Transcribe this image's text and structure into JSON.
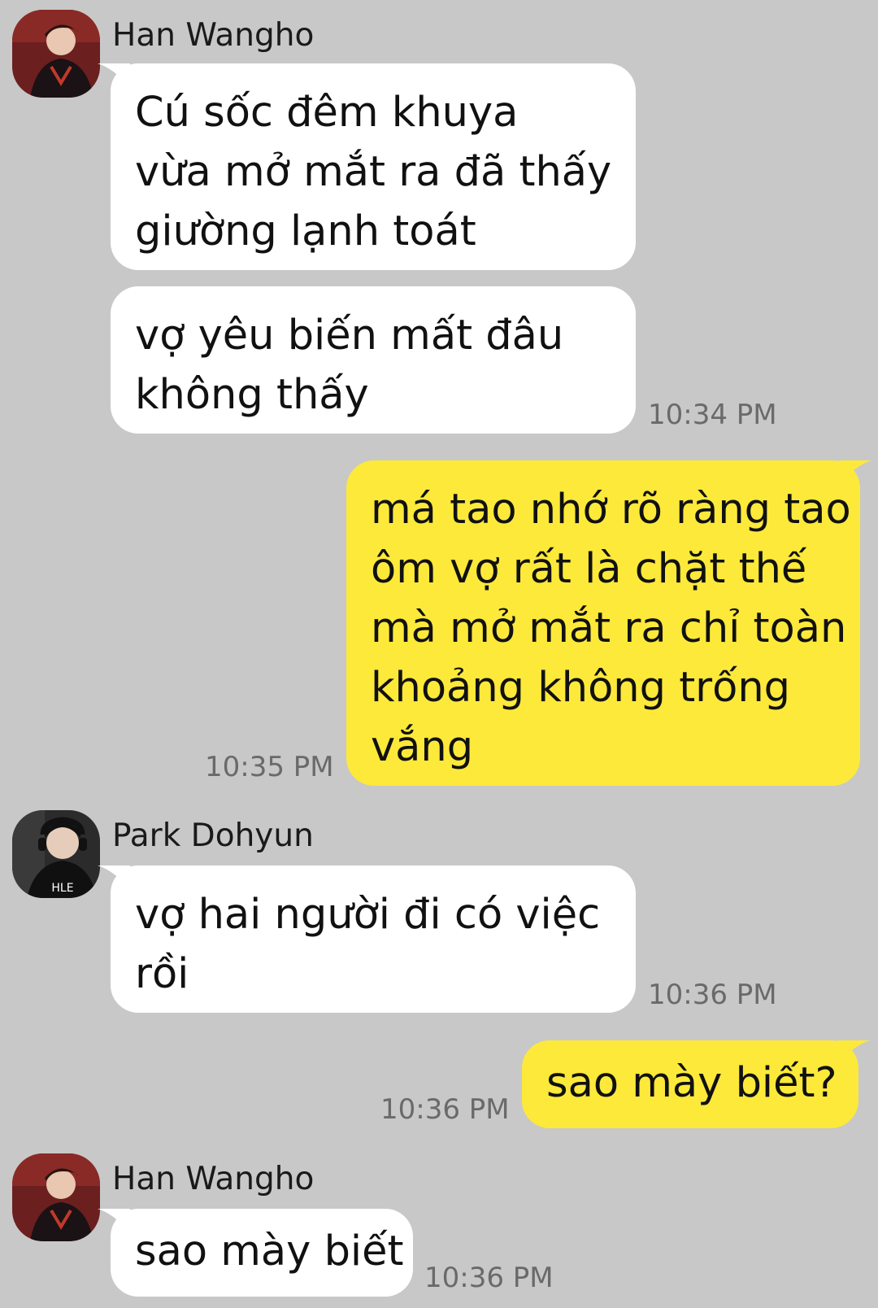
{
  "messages": [
    {
      "sender": "Han Wangho",
      "avatar": "han-wangho-avatar",
      "bubbles": [
        {
          "lines": [
            "Cú sốc đêm khuya",
            "vừa mở mắt ra đã thấy",
            "giường lạnh toát"
          ]
        },
        {
          "lines": [
            "vợ yêu biến mất đâu",
            "không thấy"
          ],
          "time": "10:34 PM"
        }
      ]
    },
    {
      "outgoing": true,
      "bubbles": [
        {
          "lines": [
            "má tao nhớ rõ ràng tao",
            "ôm vợ rất là chặt thế",
            "mà mở mắt ra chỉ toàn",
            "khoảng không trống",
            "vắng"
          ],
          "time": "10:35 PM"
        }
      ]
    },
    {
      "sender": "Park Dohyun",
      "avatar": "park-dohyun-avatar",
      "bubbles": [
        {
          "lines": [
            "vợ hai người đi có việc",
            "rồi"
          ],
          "time": "10:36 PM"
        }
      ]
    },
    {
      "outgoing": true,
      "bubbles": [
        {
          "lines": [
            "sao mày biết?"
          ],
          "time": "10:36 PM"
        }
      ]
    },
    {
      "sender": "Han Wangho",
      "avatar": "han-wangho-avatar",
      "bubbles": [
        {
          "lines": [
            "sao mày biết"
          ],
          "time": "10:36 PM"
        }
      ]
    }
  ],
  "colors": {
    "background": "#c8c8c8",
    "incoming_bubble": "#ffffff",
    "outgoing_bubble": "#fde93a",
    "timestamp": "#6a6a6a"
  }
}
